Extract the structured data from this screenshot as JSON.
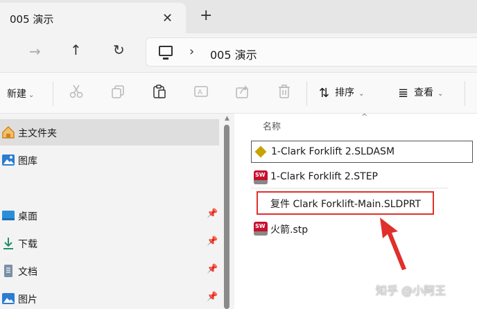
{
  "tab": {
    "title": "005 演示",
    "close_glyph": "✕",
    "new_glyph": "+"
  },
  "nav": {
    "forward_glyph": "→",
    "up_glyph": "↑",
    "refresh_glyph": "↻",
    "sep_glyph": "›"
  },
  "address": {
    "path": "005 演示"
  },
  "toolbar": {
    "new_label": "新建",
    "caret": "⌄",
    "sort_label": "排序",
    "sort_icon": "⇅",
    "view_label": "查看",
    "view_icon": "≣",
    "icons": [
      "cut-icon",
      "copy-icon",
      "paste-icon",
      "rename-icon",
      "share-icon",
      "delete-icon"
    ]
  },
  "sidebar": {
    "items": [
      {
        "label": "主文件夹",
        "icon": "home-icon",
        "pinned": false,
        "active": true
      },
      {
        "label": "图库",
        "icon": "gallery-icon",
        "pinned": false,
        "active": false
      },
      {
        "label": "桌面",
        "icon": "desktop-icon",
        "pinned": true,
        "active": false
      },
      {
        "label": "下载",
        "icon": "download-icon",
        "pinned": true,
        "active": false
      },
      {
        "label": "文档",
        "icon": "documents-icon",
        "pinned": true,
        "active": false
      },
      {
        "label": "图片",
        "icon": "pictures-icon",
        "pinned": true,
        "active": false
      }
    ]
  },
  "content": {
    "column_name": "名称",
    "sort_caret": "^",
    "files": [
      {
        "name": "1-Clark Forklift 2.SLDASM",
        "icon": "solidworks-assembly-icon",
        "focused": true
      },
      {
        "name": "1-Clark Forklift 2.STEP",
        "icon": "solidworks-file-icon",
        "focused": false
      },
      {
        "name": "复件 Clark Forklift-Main.SLDPRT",
        "icon": "",
        "focused": false,
        "renaming": true
      },
      {
        "name": "火箭.stp",
        "icon": "solidworks-file-icon",
        "focused": false
      }
    ]
  },
  "annotation": {
    "arrow_color": "#e0302b"
  },
  "watermark": {
    "text": "知乎 @小阿王"
  },
  "colors": {
    "accent": "#e0302b",
    "selection": "#dedede",
    "window_bg": "#f3f3f3"
  }
}
